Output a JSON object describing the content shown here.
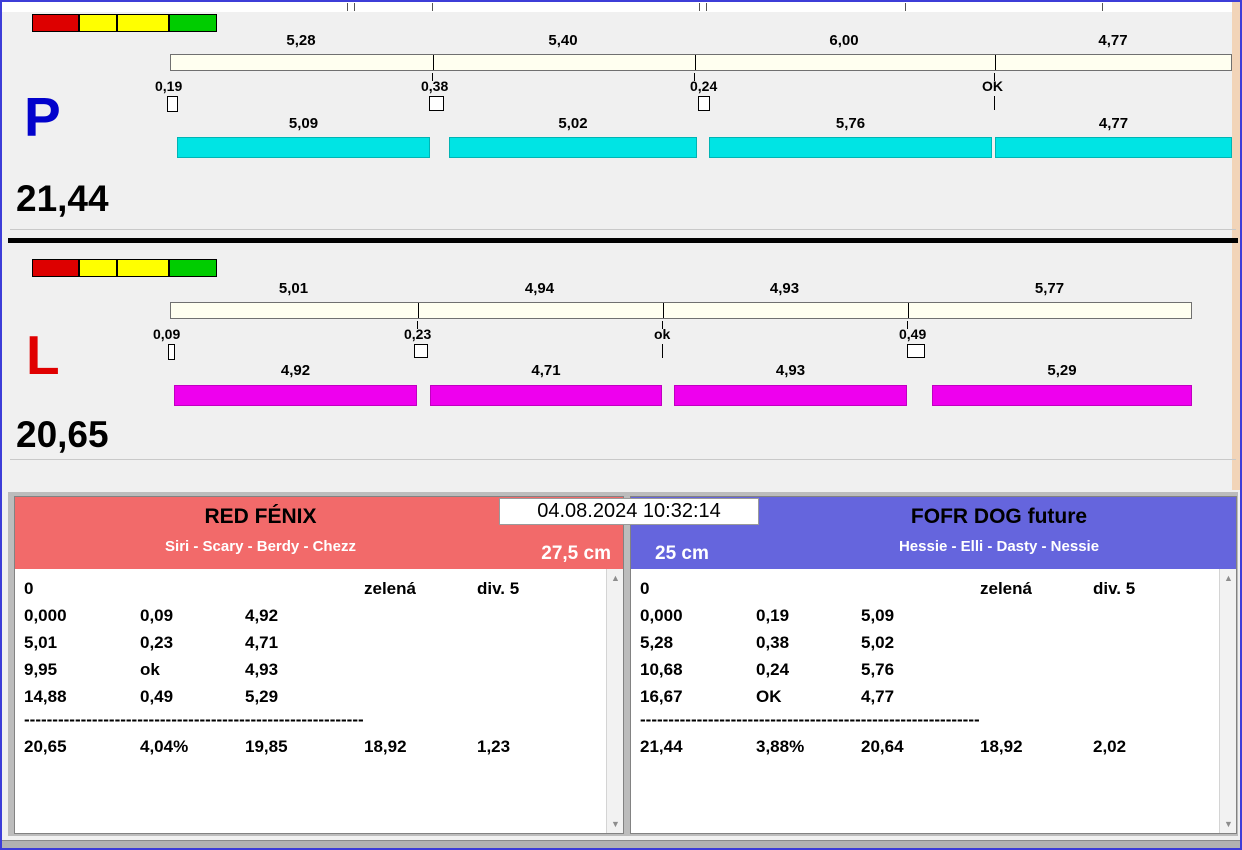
{
  "window": {
    "timestamp": "04.08.2024 10:32:14",
    "scroll_up_glyph": "▲",
    "scroll_down_glyph": "▼"
  },
  "lanes": {
    "p": {
      "letter": "P",
      "total": "21,44",
      "splits_top": [
        "5,28",
        "5,40",
        "6,00",
        "4,77"
      ],
      "markers": [
        "0,19",
        "0,38",
        "0,24",
        "OK"
      ],
      "splits_bottom": [
        "5,09",
        "5,02",
        "5,76",
        "4,77"
      ]
    },
    "l": {
      "letter": "L",
      "total": "20,65",
      "splits_top": [
        "5,01",
        "4,94",
        "4,93",
        "5,77"
      ],
      "markers": [
        "0,09",
        "0,23",
        "ok",
        "0,49"
      ],
      "splits_bottom": [
        "4,92",
        "4,71",
        "4,93",
        "5,29"
      ]
    }
  },
  "teams": {
    "left": {
      "name": "RED FÉNIX",
      "dogs": "Siri - Scary - Berdy - Chezz",
      "jump_height": "27,5 cm",
      "rows": [
        [
          "0",
          "",
          "",
          "zelená",
          "div. 5"
        ],
        [
          "0,000",
          "0,09",
          "4,92",
          "",
          ""
        ],
        [
          "5,01",
          "0,23",
          "4,71",
          "",
          ""
        ],
        [
          "9,95",
          "ok",
          "4,93",
          "",
          ""
        ],
        [
          "14,88",
          "0,49",
          "5,29",
          "",
          ""
        ],
        [
          "20,65",
          "4,04%",
          "19,85",
          "18,92",
          "1,23"
        ]
      ],
      "separator": "------------------------------------------------------------"
    },
    "right": {
      "name": "FOFR DOG future",
      "dogs": "Hessie - Elli - Dasty - Nessie",
      "jump_height": "25 cm",
      "rows": [
        [
          "0",
          "",
          "",
          "zelená",
          "div. 5"
        ],
        [
          "0,000",
          "0,19",
          "5,09",
          "",
          ""
        ],
        [
          "5,28",
          "0,38",
          "5,02",
          "",
          ""
        ],
        [
          "10,68",
          "0,24",
          "5,76",
          "",
          ""
        ],
        [
          "16,67",
          "OK",
          "4,77",
          "",
          ""
        ],
        [
          "21,44",
          "3,88%",
          "20,64",
          "18,92",
          "2,02"
        ]
      ],
      "separator": "------------------------------------------------------------"
    }
  },
  "colors": {
    "lane_p_letter": "#0202cc",
    "lane_l_letter": "#e00000",
    "lane_p_bar": "#00e4e4",
    "lane_l_bar": "#ee00ee",
    "split_track": "#fffff0",
    "team_left_header": "#f26a6a",
    "team_right_header": "#6565dd",
    "indicator_boxes": [
      "#dd0000",
      "#ffff00",
      "#ffff00",
      "#00cc00"
    ]
  }
}
